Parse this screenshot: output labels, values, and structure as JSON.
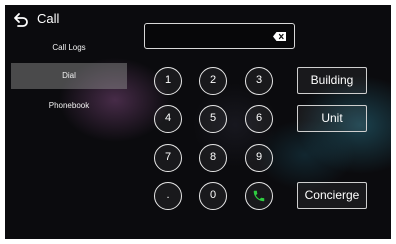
{
  "header": {
    "title": "Call",
    "back_icon": "back-arrow-icon"
  },
  "sidebar": {
    "items": [
      {
        "label": "Call Logs",
        "active": false
      },
      {
        "label": "Dial",
        "active": true
      },
      {
        "label": "Phonebook",
        "active": false
      }
    ]
  },
  "dialer": {
    "input_value": "",
    "backspace_icon": "backspace-icon",
    "keys": [
      "1",
      "2",
      "3",
      "4",
      "5",
      "6",
      "7",
      "8",
      "9",
      ".",
      "0"
    ],
    "call_icon": "phone-icon",
    "call_icon_color": "#2ecc40"
  },
  "actions": {
    "building_label": "Building",
    "unit_label": "Unit",
    "concierge_label": "Concierge"
  }
}
